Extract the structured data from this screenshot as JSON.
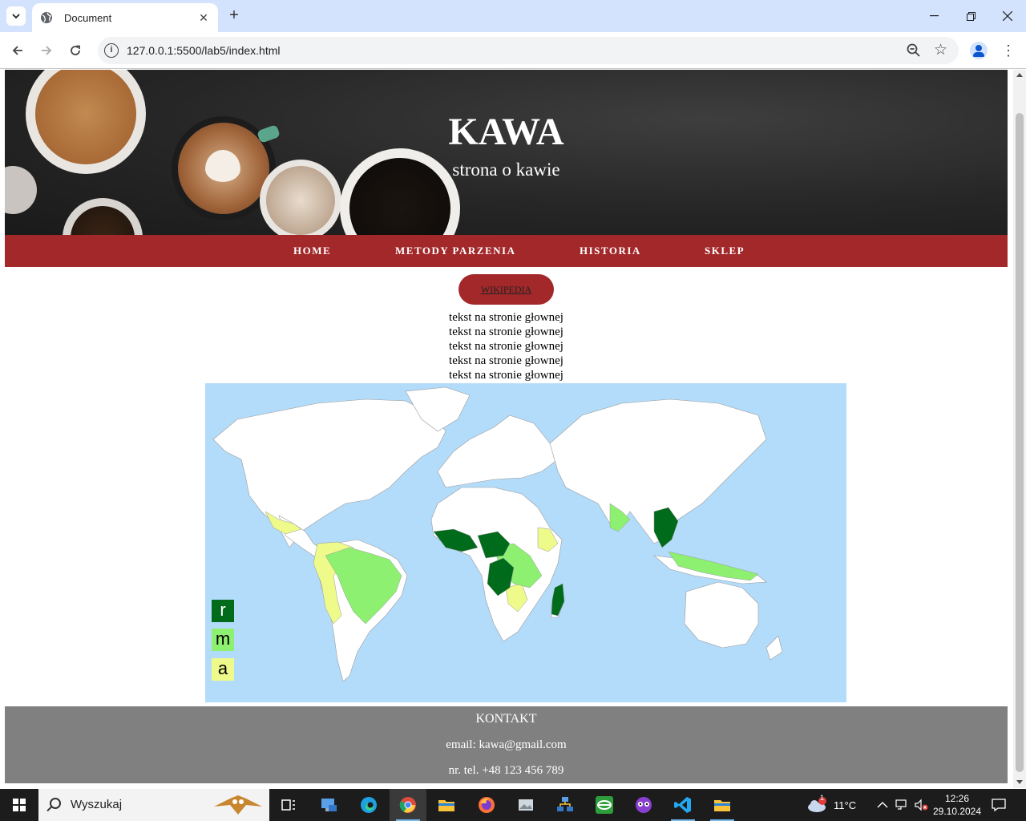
{
  "browser": {
    "tab_title": "Document",
    "url": "127.0.0.1:5500/lab5/index.html"
  },
  "page": {
    "title": "KAWA",
    "subtitle": "strona o kawie",
    "nav": [
      "HOME",
      "METODY PARZENIA",
      "HISTORIA",
      "SKLEP"
    ],
    "wiki_button": "WIKIPEDIA",
    "text_lines": [
      "tekst na stronie głownej",
      "tekst na stronie głownej",
      "tekst na stronie głownej",
      "tekst na stronie głownej",
      "tekst na stronie głownej"
    ],
    "map_legend": [
      {
        "label": "r",
        "color": "#006b1a",
        "text_color": "#ffffff"
      },
      {
        "label": "m",
        "color": "#8ef070",
        "text_color": "#000000"
      },
      {
        "label": "a",
        "color": "#eefa8a",
        "text_color": "#000000"
      }
    ],
    "footer": {
      "heading": "KONTAKT",
      "email": "email: kawa@gmail.com",
      "phone": "nr. tel. +48 123 456 789"
    },
    "colors": {
      "accent": "#a3282a",
      "footer_bg": "#808080",
      "ocean": "#b3dcfb"
    }
  },
  "taskbar": {
    "search_placeholder": "Wyszukaj",
    "weather_badge": "1",
    "temperature": "11°C",
    "time": "12:26",
    "date": "29.10.2024"
  }
}
